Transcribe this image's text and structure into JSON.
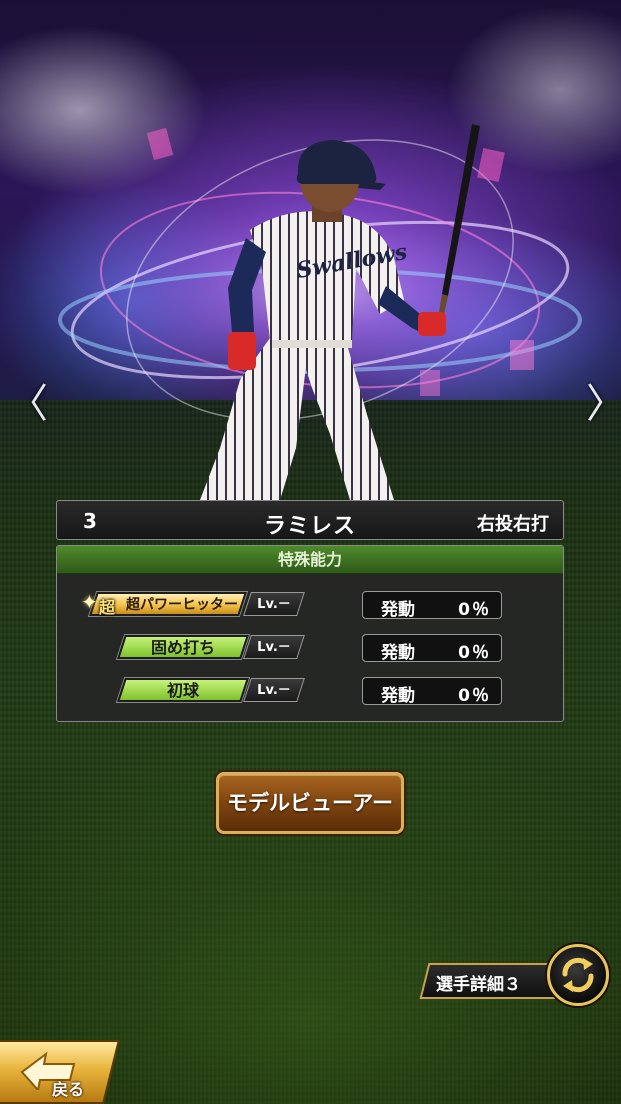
{
  "player": {
    "number": "3",
    "name": "ラミレス",
    "handedness": "右投右打",
    "jersey_text": "Swallows"
  },
  "abilities": {
    "header": "特殊能力",
    "items": [
      {
        "super_mark": "超",
        "name": "超パワーヒッター",
        "level": "Lv.－",
        "activation_label": "発動",
        "activation_value": "0％",
        "style": "gold"
      },
      {
        "name": "固め打ち",
        "level": "Lv.－",
        "activation_label": "発動",
        "activation_value": "0％",
        "style": "green"
      },
      {
        "name": "初球",
        "level": "Lv.－",
        "activation_label": "発動",
        "activation_value": "0％",
        "style": "green"
      }
    ]
  },
  "buttons": {
    "model_viewer": "モデルビューアー",
    "player_detail": "選手詳細３",
    "back": "戻る"
  },
  "navigation": {
    "prev_arrow": "〈",
    "next_arrow": "〉"
  },
  "colors": {
    "ability_header": "#3f7a22",
    "gold_tag": "#f2c24a",
    "green_tag": "#9edb46",
    "model_button": "#7e4410"
  },
  "icons": [
    "chevron-left-icon",
    "chevron-right-icon",
    "star-icon",
    "swap-icon",
    "back-arrow-icon"
  ]
}
